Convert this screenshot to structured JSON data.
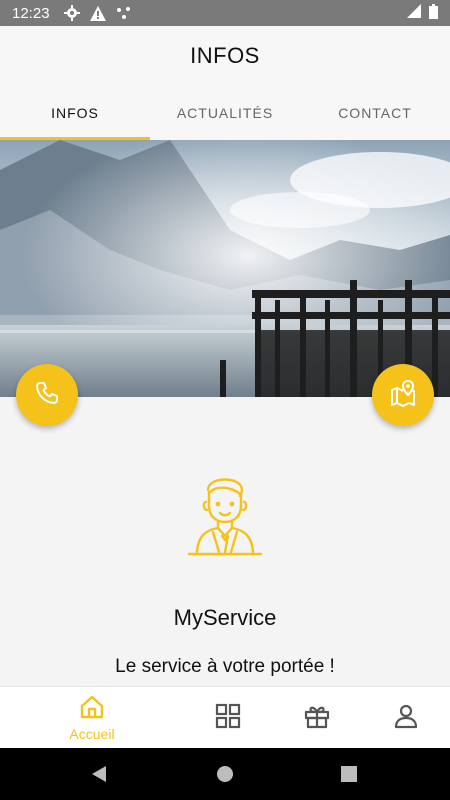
{
  "status_bar": {
    "time": "12:23"
  },
  "header": {
    "title": "INFOS"
  },
  "tabs": [
    {
      "label": "INFOS",
      "active": true
    },
    {
      "label": "ACTUALITÉS",
      "active": false
    },
    {
      "label": "CONTACT",
      "active": false
    }
  ],
  "service": {
    "name": "MyService",
    "tagline": "Le service à votre portée !"
  },
  "bottom_nav": {
    "items": [
      {
        "label": "Accueil",
        "icon": "home-icon",
        "active": true
      },
      {
        "label": "",
        "icon": "grid-icon",
        "active": false
      },
      {
        "label": "",
        "icon": "gift-icon",
        "active": false
      },
      {
        "label": "",
        "icon": "profile-icon",
        "active": false
      }
    ]
  },
  "colors": {
    "accent": "#f5c21a",
    "status_bar": "#7a7a7a",
    "background": "#f4f4f4"
  }
}
